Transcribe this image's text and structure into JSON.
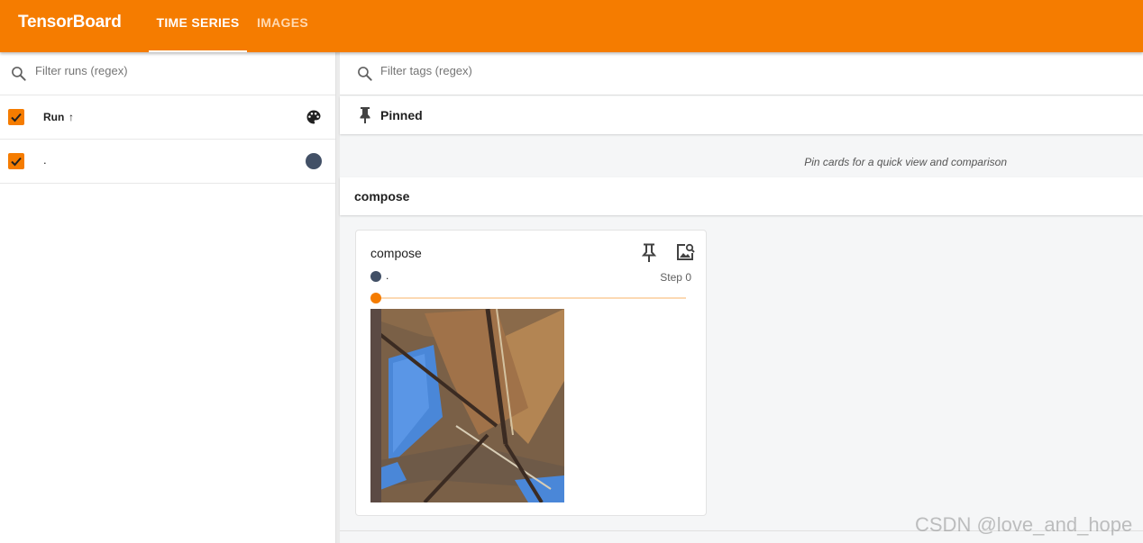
{
  "app": {
    "title": "TensorBoard"
  },
  "tabs": [
    {
      "label": "TIME SERIES",
      "active": true
    },
    {
      "label": "IMAGES",
      "active": false
    }
  ],
  "sidebar": {
    "search": {
      "placeholder": "Filter runs (regex)",
      "value": ""
    },
    "header": {
      "label": "Run",
      "sort_icon": "↑",
      "checked": true
    },
    "runs": [
      {
        "name": ".",
        "checked": true,
        "color": "#425066"
      }
    ]
  },
  "main": {
    "search": {
      "placeholder": "Filter tags (regex)",
      "value": ""
    },
    "pinned": {
      "title": "Pinned",
      "empty_note": "Pin cards for a quick view and comparison"
    },
    "group": {
      "title": "compose"
    },
    "card": {
      "title": "compose",
      "run_name": ".",
      "run_color": "#425066",
      "step_label": "Step 0",
      "slider_value": 0
    }
  },
  "watermark": "CSDN @love_and_hope",
  "colors": {
    "accent": "#f57c00",
    "run": "#425066"
  }
}
